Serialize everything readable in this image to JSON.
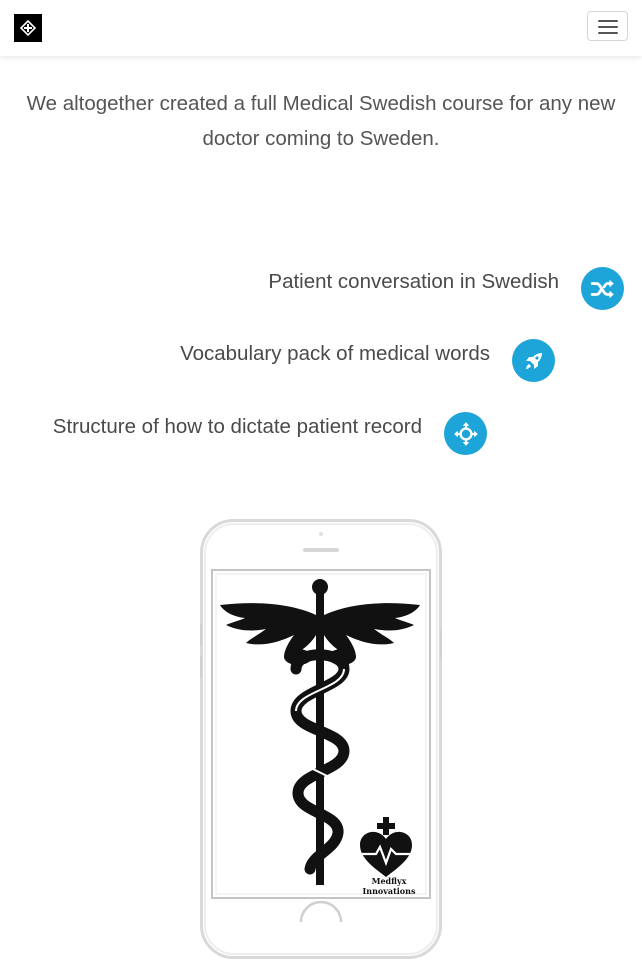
{
  "navbar": {
    "brand_icon": "diamond-cross-logo",
    "toggle_icon": "hamburger-menu-icon"
  },
  "intro": {
    "text": "We altogether created a full Medical Swedish course for any new doctor coming to Sweden."
  },
  "features": [
    {
      "label": "Patient conversation in Swedish",
      "icon": "shuffle-icon"
    },
    {
      "label": "Vocabulary pack of medical words",
      "icon": "rocket-icon"
    },
    {
      "label": "Structure of how to dictate patient record",
      "icon": "crosshair-arrows-icon"
    }
  ],
  "phone": {
    "logo_line1": "Medflyx",
    "logo_line2": "Innovations"
  },
  "colors": {
    "accent": "#1da4d8",
    "text": "#4a4a4a",
    "brand_bg": "#000000"
  }
}
